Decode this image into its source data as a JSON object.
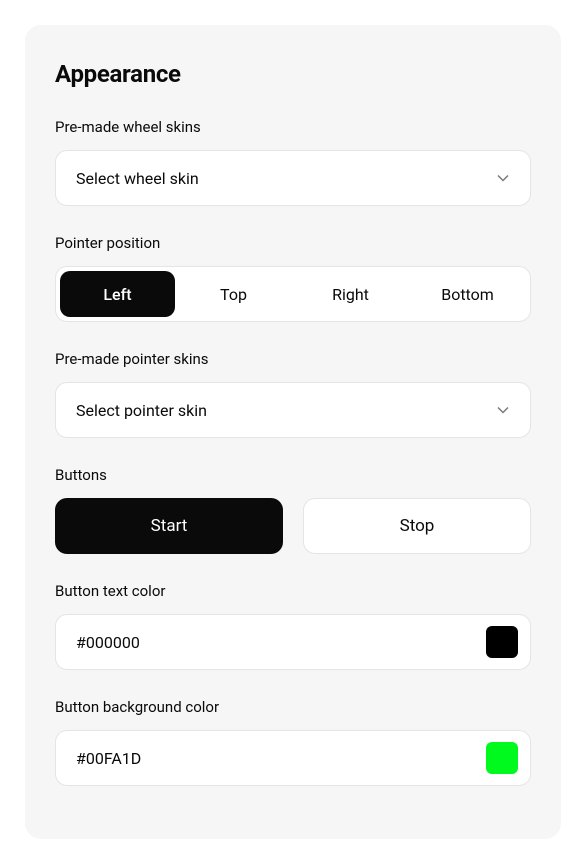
{
  "title": "Appearance",
  "wheelSkins": {
    "label": "Pre-made wheel skins",
    "placeholder": "Select wheel skin"
  },
  "pointerPosition": {
    "label": "Pointer position",
    "options": [
      "Left",
      "Top",
      "Right",
      "Bottom"
    ],
    "selected": "Left"
  },
  "pointerSkins": {
    "label": "Pre-made pointer skins",
    "placeholder": "Select pointer skin"
  },
  "buttons": {
    "label": "Buttons",
    "start": "Start",
    "stop": "Stop"
  },
  "buttonTextColor": {
    "label": "Button text color",
    "value": "#000000",
    "swatch": "#000000"
  },
  "buttonBgColor": {
    "label": "Button background color",
    "value": "#00FA1D",
    "swatch": "#00FA1D"
  }
}
